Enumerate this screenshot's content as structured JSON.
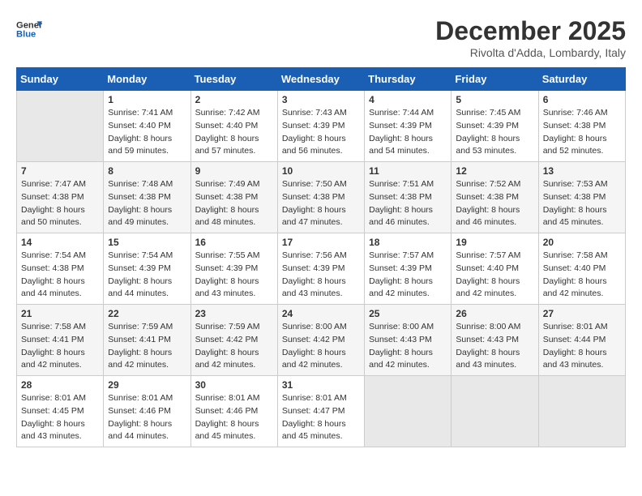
{
  "header": {
    "logo_line1": "General",
    "logo_line2": "Blue",
    "month": "December 2025",
    "location": "Rivolta d'Adda, Lombardy, Italy"
  },
  "days_of_week": [
    "Sunday",
    "Monday",
    "Tuesday",
    "Wednesday",
    "Thursday",
    "Friday",
    "Saturday"
  ],
  "weeks": [
    [
      {
        "day": "",
        "info": ""
      },
      {
        "day": "1",
        "info": "Sunrise: 7:41 AM\nSunset: 4:40 PM\nDaylight: 8 hours\nand 59 minutes."
      },
      {
        "day": "2",
        "info": "Sunrise: 7:42 AM\nSunset: 4:40 PM\nDaylight: 8 hours\nand 57 minutes."
      },
      {
        "day": "3",
        "info": "Sunrise: 7:43 AM\nSunset: 4:39 PM\nDaylight: 8 hours\nand 56 minutes."
      },
      {
        "day": "4",
        "info": "Sunrise: 7:44 AM\nSunset: 4:39 PM\nDaylight: 8 hours\nand 54 minutes."
      },
      {
        "day": "5",
        "info": "Sunrise: 7:45 AM\nSunset: 4:39 PM\nDaylight: 8 hours\nand 53 minutes."
      },
      {
        "day": "6",
        "info": "Sunrise: 7:46 AM\nSunset: 4:38 PM\nDaylight: 8 hours\nand 52 minutes."
      }
    ],
    [
      {
        "day": "7",
        "info": "Sunrise: 7:47 AM\nSunset: 4:38 PM\nDaylight: 8 hours\nand 50 minutes."
      },
      {
        "day": "8",
        "info": "Sunrise: 7:48 AM\nSunset: 4:38 PM\nDaylight: 8 hours\nand 49 minutes."
      },
      {
        "day": "9",
        "info": "Sunrise: 7:49 AM\nSunset: 4:38 PM\nDaylight: 8 hours\nand 48 minutes."
      },
      {
        "day": "10",
        "info": "Sunrise: 7:50 AM\nSunset: 4:38 PM\nDaylight: 8 hours\nand 47 minutes."
      },
      {
        "day": "11",
        "info": "Sunrise: 7:51 AM\nSunset: 4:38 PM\nDaylight: 8 hours\nand 46 minutes."
      },
      {
        "day": "12",
        "info": "Sunrise: 7:52 AM\nSunset: 4:38 PM\nDaylight: 8 hours\nand 46 minutes."
      },
      {
        "day": "13",
        "info": "Sunrise: 7:53 AM\nSunset: 4:38 PM\nDaylight: 8 hours\nand 45 minutes."
      }
    ],
    [
      {
        "day": "14",
        "info": "Sunrise: 7:54 AM\nSunset: 4:38 PM\nDaylight: 8 hours\nand 44 minutes."
      },
      {
        "day": "15",
        "info": "Sunrise: 7:54 AM\nSunset: 4:39 PM\nDaylight: 8 hours\nand 44 minutes."
      },
      {
        "day": "16",
        "info": "Sunrise: 7:55 AM\nSunset: 4:39 PM\nDaylight: 8 hours\nand 43 minutes."
      },
      {
        "day": "17",
        "info": "Sunrise: 7:56 AM\nSunset: 4:39 PM\nDaylight: 8 hours\nand 43 minutes."
      },
      {
        "day": "18",
        "info": "Sunrise: 7:57 AM\nSunset: 4:39 PM\nDaylight: 8 hours\nand 42 minutes."
      },
      {
        "day": "19",
        "info": "Sunrise: 7:57 AM\nSunset: 4:40 PM\nDaylight: 8 hours\nand 42 minutes."
      },
      {
        "day": "20",
        "info": "Sunrise: 7:58 AM\nSunset: 4:40 PM\nDaylight: 8 hours\nand 42 minutes."
      }
    ],
    [
      {
        "day": "21",
        "info": "Sunrise: 7:58 AM\nSunset: 4:41 PM\nDaylight: 8 hours\nand 42 minutes."
      },
      {
        "day": "22",
        "info": "Sunrise: 7:59 AM\nSunset: 4:41 PM\nDaylight: 8 hours\nand 42 minutes."
      },
      {
        "day": "23",
        "info": "Sunrise: 7:59 AM\nSunset: 4:42 PM\nDaylight: 8 hours\nand 42 minutes."
      },
      {
        "day": "24",
        "info": "Sunrise: 8:00 AM\nSunset: 4:42 PM\nDaylight: 8 hours\nand 42 minutes."
      },
      {
        "day": "25",
        "info": "Sunrise: 8:00 AM\nSunset: 4:43 PM\nDaylight: 8 hours\nand 42 minutes."
      },
      {
        "day": "26",
        "info": "Sunrise: 8:00 AM\nSunset: 4:43 PM\nDaylight: 8 hours\nand 43 minutes."
      },
      {
        "day": "27",
        "info": "Sunrise: 8:01 AM\nSunset: 4:44 PM\nDaylight: 8 hours\nand 43 minutes."
      }
    ],
    [
      {
        "day": "28",
        "info": "Sunrise: 8:01 AM\nSunset: 4:45 PM\nDaylight: 8 hours\nand 43 minutes."
      },
      {
        "day": "29",
        "info": "Sunrise: 8:01 AM\nSunset: 4:46 PM\nDaylight: 8 hours\nand 44 minutes."
      },
      {
        "day": "30",
        "info": "Sunrise: 8:01 AM\nSunset: 4:46 PM\nDaylight: 8 hours\nand 45 minutes."
      },
      {
        "day": "31",
        "info": "Sunrise: 8:01 AM\nSunset: 4:47 PM\nDaylight: 8 hours\nand 45 minutes."
      },
      {
        "day": "",
        "info": ""
      },
      {
        "day": "",
        "info": ""
      },
      {
        "day": "",
        "info": ""
      }
    ]
  ]
}
